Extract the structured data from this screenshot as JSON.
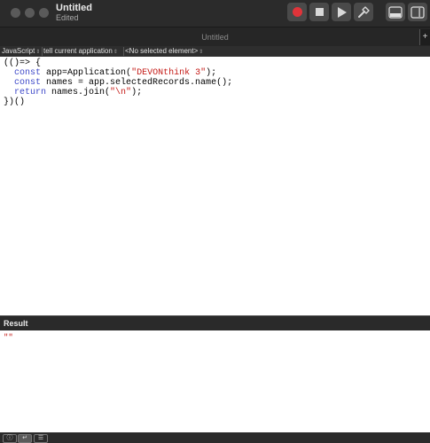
{
  "window": {
    "title": "Untitled",
    "subtitle": "Edited"
  },
  "toolbar": {
    "buttons": [
      {
        "name": "record",
        "icon": "record-icon",
        "color": "#e0343a"
      },
      {
        "name": "stop",
        "icon": "stop-icon"
      },
      {
        "name": "run",
        "icon": "play-icon"
      },
      {
        "name": "compile",
        "icon": "hammer-icon"
      },
      {
        "name": "show-log",
        "icon": "panel-bottom-icon"
      },
      {
        "name": "show-library",
        "icon": "panel-right-icon"
      }
    ]
  },
  "tabbar": {
    "title": "Untitled",
    "add_icon": "+"
  },
  "navigation": {
    "language": "JavaScript",
    "target": "tell current application",
    "element": "<No selected element>"
  },
  "editor": {
    "lines": [
      "(()=> {",
      "  const app=Application(\"DEVONthink 3\");",
      "  const names = app.selectedRecords.name();",
      "  return names.join(\"\\n\");",
      "})()"
    ],
    "colors": {
      "keyword": "#3b46c8",
      "string": "#c41a16"
    }
  },
  "result": {
    "header": "Result",
    "value": "\"\""
  },
  "bottom": {
    "segments": [
      {
        "name": "info",
        "icon": "info-icon",
        "glyph": "ⓘ"
      },
      {
        "name": "result-view",
        "icon": "return-arrow-icon",
        "glyph": "↵"
      },
      {
        "name": "log-view",
        "icon": "list-icon",
        "glyph": "☰"
      }
    ]
  }
}
